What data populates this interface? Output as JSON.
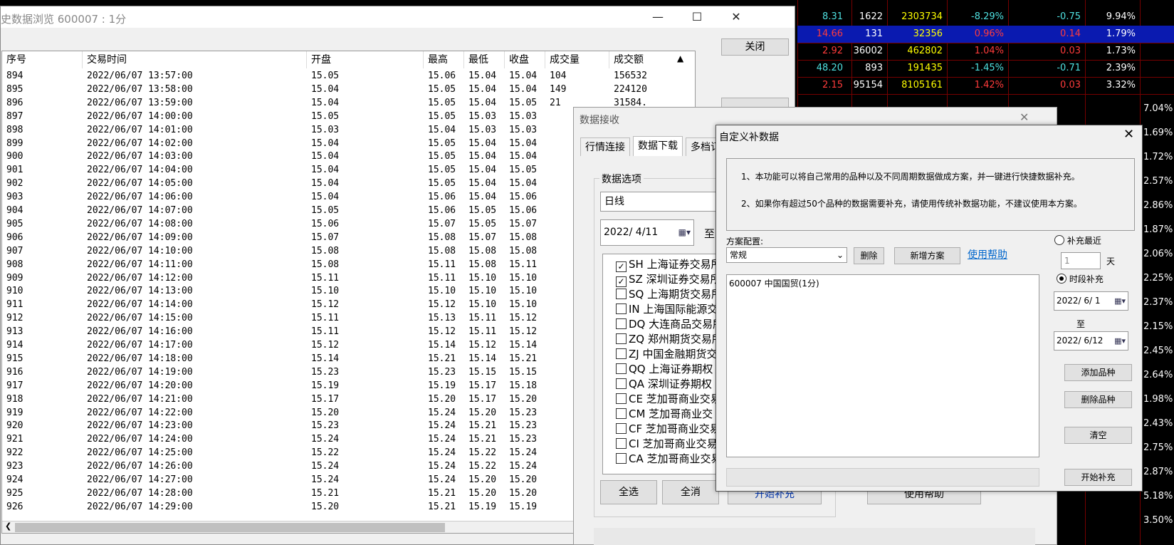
{
  "stock_rows": [
    {
      "c1": "8.31",
      "c2": "1622",
      "c3": "2303734",
      "c4": "-8.29%",
      "c5": "-0.75",
      "c6": "9.94%",
      "color": "#4fe0e0"
    },
    {
      "c1": "14.66",
      "c2": "131",
      "c3": "32356",
      "c4": "0.96%",
      "c5": "0.14",
      "c6": "1.79%",
      "color": "#ff3b3b"
    },
    {
      "c1": "2.92",
      "c2": "36002",
      "c3": "462802",
      "c4": "1.04%",
      "c5": "0.03",
      "c6": "1.73%",
      "color": "#ff3b3b"
    },
    {
      "c1": "48.20",
      "c2": "893",
      "c3": "191435",
      "c4": "-1.45%",
      "c5": "-0.71",
      "c6": "2.39%",
      "color": "#4fe0e0"
    },
    {
      "c1": "2.15",
      "c2": "95154",
      "c3": "8105161",
      "c4": "1.42%",
      "c5": "0.03",
      "c6": "3.32%",
      "color": "#ff3b3b"
    }
  ],
  "right_pct": [
    "7.04%",
    "1.69%",
    "1.72%",
    "2.57%",
    "2.86%",
    "1.87%",
    "2.06%",
    "2.25%",
    "2.37%",
    "2.15%",
    "2.45%",
    "2.64%",
    "1.98%",
    "2.43%",
    "2.75%",
    "2.87%",
    "5.18%",
    "3.50%"
  ],
  "history": {
    "title": "史数据浏览 600007 : 1分",
    "close_button": "关闭",
    "columns": [
      "序号",
      "交易时间",
      "开盘",
      "最高",
      "最低",
      "收盘",
      "成交量",
      "成交额"
    ],
    "rows": [
      [
        "894",
        "2022/06/07 13:57:00",
        "15.05",
        "15.06",
        "15.04",
        "15.04",
        "104",
        "156532"
      ],
      [
        "895",
        "2022/06/07 13:58:00",
        "15.04",
        "15.05",
        "15.04",
        "15.04",
        "149",
        "224120"
      ],
      [
        "896",
        "2022/06/07 13:59:00",
        "15.04",
        "15.05",
        "15.04",
        "15.05",
        "21",
        "31584."
      ],
      [
        "897",
        "2022/06/07 14:00:00",
        "15.05",
        "15.05",
        "15.03",
        "15.03",
        "",
        ""
      ],
      [
        "898",
        "2022/06/07 14:01:00",
        "15.03",
        "15.04",
        "15.03",
        "15.03",
        "",
        ""
      ],
      [
        "899",
        "2022/06/07 14:02:00",
        "15.04",
        "15.05",
        "15.04",
        "15.04",
        "",
        ""
      ],
      [
        "900",
        "2022/06/07 14:03:00",
        "15.04",
        "15.05",
        "15.04",
        "15.04",
        "",
        ""
      ],
      [
        "901",
        "2022/06/07 14:04:00",
        "15.04",
        "15.05",
        "15.04",
        "15.05",
        "",
        ""
      ],
      [
        "902",
        "2022/06/07 14:05:00",
        "15.04",
        "15.05",
        "15.04",
        "15.04",
        "",
        ""
      ],
      [
        "903",
        "2022/06/07 14:06:00",
        "15.04",
        "15.06",
        "15.04",
        "15.06",
        "",
        ""
      ],
      [
        "904",
        "2022/06/07 14:07:00",
        "15.05",
        "15.06",
        "15.05",
        "15.06",
        "",
        ""
      ],
      [
        "905",
        "2022/06/07 14:08:00",
        "15.06",
        "15.07",
        "15.05",
        "15.07",
        "",
        ""
      ],
      [
        "906",
        "2022/06/07 14:09:00",
        "15.07",
        "15.08",
        "15.07",
        "15.08",
        "",
        ""
      ],
      [
        "907",
        "2022/06/07 14:10:00",
        "15.08",
        "15.08",
        "15.08",
        "15.08",
        "",
        ""
      ],
      [
        "908",
        "2022/06/07 14:11:00",
        "15.08",
        "15.11",
        "15.08",
        "15.11",
        "",
        ""
      ],
      [
        "909",
        "2022/06/07 14:12:00",
        "15.11",
        "15.11",
        "15.10",
        "15.10",
        "",
        ""
      ],
      [
        "910",
        "2022/06/07 14:13:00",
        "15.10",
        "15.10",
        "15.10",
        "15.10",
        "",
        ""
      ],
      [
        "911",
        "2022/06/07 14:14:00",
        "15.12",
        "15.12",
        "15.10",
        "15.10",
        "",
        ""
      ],
      [
        "912",
        "2022/06/07 14:15:00",
        "15.11",
        "15.13",
        "15.11",
        "15.12",
        "",
        ""
      ],
      [
        "913",
        "2022/06/07 14:16:00",
        "15.11",
        "15.12",
        "15.11",
        "15.12",
        "",
        ""
      ],
      [
        "914",
        "2022/06/07 14:17:00",
        "15.12",
        "15.14",
        "15.12",
        "15.14",
        "",
        ""
      ],
      [
        "915",
        "2022/06/07 14:18:00",
        "15.14",
        "15.21",
        "15.14",
        "15.21",
        "",
        ""
      ],
      [
        "916",
        "2022/06/07 14:19:00",
        "15.23",
        "15.23",
        "15.15",
        "15.15",
        "",
        ""
      ],
      [
        "917",
        "2022/06/07 14:20:00",
        "15.19",
        "15.19",
        "15.17",
        "15.18",
        "",
        ""
      ],
      [
        "918",
        "2022/06/07 14:21:00",
        "15.17",
        "15.20",
        "15.17",
        "15.20",
        "",
        ""
      ],
      [
        "919",
        "2022/06/07 14:22:00",
        "15.20",
        "15.24",
        "15.20",
        "15.23",
        "",
        ""
      ],
      [
        "920",
        "2022/06/07 14:23:00",
        "15.23",
        "15.24",
        "15.21",
        "15.23",
        "",
        ""
      ],
      [
        "921",
        "2022/06/07 14:24:00",
        "15.24",
        "15.24",
        "15.21",
        "15.23",
        "",
        ""
      ],
      [
        "922",
        "2022/06/07 14:25:00",
        "15.22",
        "15.24",
        "15.22",
        "15.24",
        "",
        ""
      ],
      [
        "923",
        "2022/06/07 14:26:00",
        "15.24",
        "15.24",
        "15.22",
        "15.24",
        "",
        ""
      ],
      [
        "924",
        "2022/06/07 14:27:00",
        "15.24",
        "15.24",
        "15.20",
        "15.20",
        "",
        ""
      ],
      [
        "925",
        "2022/06/07 14:28:00",
        "15.21",
        "15.21",
        "15.20",
        "15.20",
        "",
        ""
      ],
      [
        "926",
        "2022/06/07 14:29:00",
        "15.20",
        "15.21",
        "15.19",
        "15.19",
        "",
        ""
      ]
    ]
  },
  "receive": {
    "title": "数据接收",
    "tabs": [
      "行情连接",
      "数据下载",
      "多档订"
    ],
    "group_label": "数据选项",
    "period": "日线",
    "date_from": "2022/  4/11",
    "to_label": "至",
    "markets": [
      {
        "label": "SH 上海证券交易所",
        "checked": true
      },
      {
        "label": "SZ 深圳证券交易所",
        "checked": true
      },
      {
        "label": "SQ 上海期货交易所",
        "checked": false
      },
      {
        "label": "IN 上海国际能源交",
        "checked": false
      },
      {
        "label": "DQ 大连商品交易所",
        "checked": false
      },
      {
        "label": "ZQ 郑州期货交易所",
        "checked": false
      },
      {
        "label": "ZJ 中国金融期货交",
        "checked": false
      },
      {
        "label": "QQ 上海证券期权",
        "checked": false
      },
      {
        "label": "QA 深圳证券期权",
        "checked": false
      },
      {
        "label": "CE 芝加哥商业交易",
        "checked": false
      },
      {
        "label": "CM 芝加哥商业交",
        "checked": false
      },
      {
        "label": "CF 芝加哥商业交易",
        "checked": false
      },
      {
        "label": "CI 芝加哥商业交易",
        "checked": false
      },
      {
        "label": "CA 芝加哥商业交易",
        "checked": false
      }
    ],
    "select_all": "全选",
    "deselect_all": "全消",
    "start_fill": "开始补充",
    "help": "使用帮助"
  },
  "custom": {
    "title": "自定义补数据",
    "info1": "1、本功能可以将自己常用的品种以及不同周期数据做成方案，并一键进行快捷数据补充。",
    "info2": "2、如果你有超过50个品种的数据需要补充，请使用传统补数据功能，不建议使用本方案。",
    "scheme_label": "方案配置:",
    "scheme_value": "常规",
    "delete_btn": "删除",
    "new_btn": "新增方案",
    "help_link": "使用帮助",
    "list_items": [
      "600007 中国国贸(1分)"
    ],
    "recent_label": "补充最近",
    "recent_value": "1",
    "days_label": "天",
    "period_label": "时段补充",
    "date_start": "2022/ 6/ 1",
    "to_label": "至",
    "date_end": "2022/ 6/12",
    "add_btn": "添加品种",
    "remove_btn": "删除品种",
    "clear_btn": "清空",
    "start_btn": "开始补充"
  },
  "colors": {
    "accent_link": "#0066cc",
    "stock_hl": "#0a1ab0"
  }
}
